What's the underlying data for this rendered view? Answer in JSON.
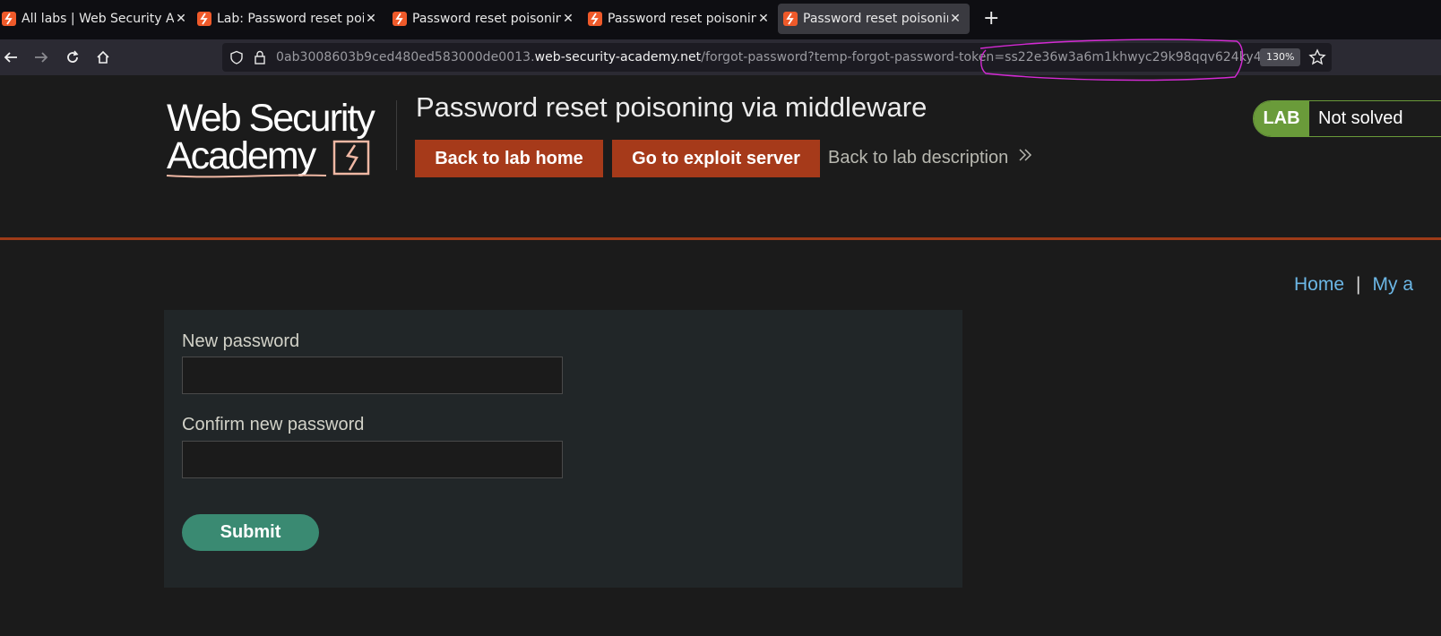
{
  "browser": {
    "tabs": [
      {
        "title": "All labs | Web Security Academy",
        "active": false
      },
      {
        "title": "Lab: Password reset poisoning via middleware",
        "active": false
      },
      {
        "title": "Password reset poisoning via middleware",
        "active": false
      },
      {
        "title": "Password reset poisoning via middleware",
        "active": false
      },
      {
        "title": "Password reset poisoning via middleware",
        "active": true
      }
    ],
    "url": {
      "subdomain": "0ab3008603b9ced480ed583000de0013.",
      "domain": "web-security-academy.net",
      "path": "/forgot-password?temp-forgot-password-token=ss22e36w3a6m1khwyc29k98qqv624ky4"
    },
    "zoom": "130%",
    "annotation_color": "#d42ad4"
  },
  "logo": {
    "line1": "Web Security",
    "line2": "Academy"
  },
  "header": {
    "lab_title": "Password reset poisoning via middleware",
    "back_to_lab_home": "Back to lab home",
    "go_to_exploit_server": "Go to exploit server",
    "back_to_lab_description": "Back to lab description",
    "lab_badge": "LAB",
    "lab_state": "Not solved"
  },
  "nav": {
    "home": "Home",
    "separator": "|",
    "my_account": "My a"
  },
  "form": {
    "new_password_label": "New password",
    "confirm_password_label": "Confirm new password",
    "submit_label": "Submit"
  },
  "colors": {
    "accent_orange": "#a63a1a",
    "lab_green": "#6a9b3a",
    "submit_green": "#3a8a72",
    "link_blue": "#6cb7e6"
  }
}
